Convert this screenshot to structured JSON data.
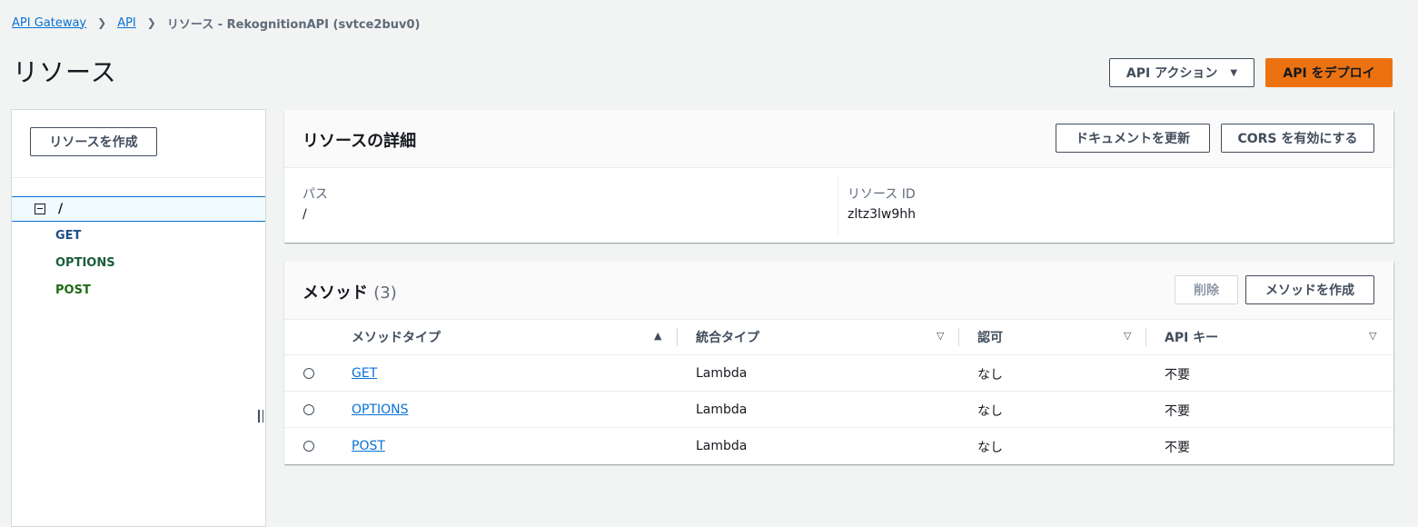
{
  "breadcrumb": {
    "items": [
      "API Gateway",
      "API"
    ],
    "current": "リソース - RekognitionAPI (svtce2buv0)"
  },
  "page": {
    "title": "リソース",
    "actions_label": "API アクション",
    "deploy_label": "API をデプロイ"
  },
  "tree": {
    "create_resource_label": "リソースを作成",
    "root": "/",
    "methods": [
      {
        "label": "GET",
        "color": "#1d4d8b"
      },
      {
        "label": "OPTIONS",
        "color": "#1b5e3b"
      },
      {
        "label": "POST",
        "color": "#1d6b14"
      }
    ]
  },
  "details": {
    "title": "リソースの詳細",
    "update_docs_label": "ドキュメントを更新",
    "enable_cors_label": "CORS を有効にする",
    "path_label": "パス",
    "path_value": "/",
    "resource_id_label": "リソース ID",
    "resource_id_value": "zltz3lw9hh"
  },
  "methods": {
    "title": "メソッド",
    "count": "(3)",
    "delete_label": "削除",
    "create_label": "メソッドを作成",
    "columns": [
      "メソッドタイプ",
      "統合タイプ",
      "認可",
      "API キー"
    ],
    "rows": [
      {
        "method": "GET",
        "integration": "Lambda",
        "auth": "なし",
        "api_key": "不要"
      },
      {
        "method": "OPTIONS",
        "integration": "Lambda",
        "auth": "なし",
        "api_key": "不要"
      },
      {
        "method": "POST",
        "integration": "Lambda",
        "auth": "なし",
        "api_key": "不要"
      }
    ]
  },
  "colors": {
    "link": "#0972d3",
    "primary": "#ec7211"
  }
}
